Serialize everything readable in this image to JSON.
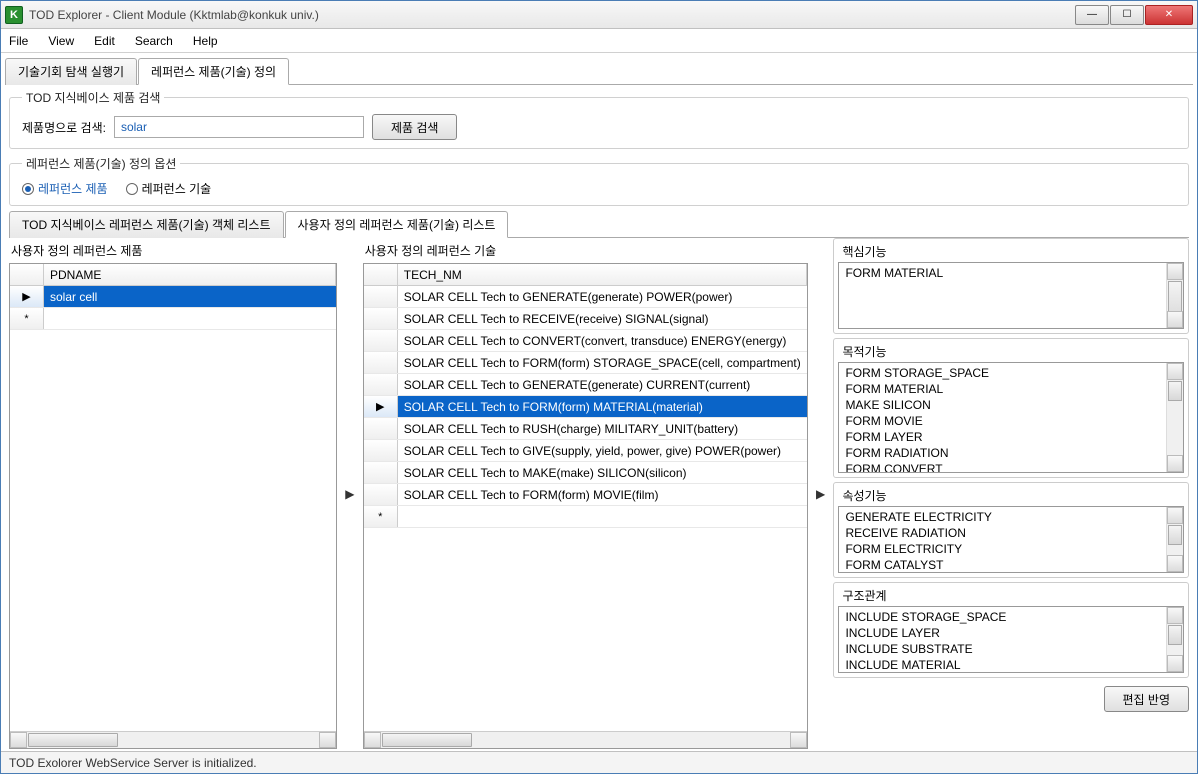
{
  "window": {
    "title": "TOD Explorer - Client Module (Kktmlab@konkuk univ.)",
    "icon_letter": "K"
  },
  "menu": {
    "file": "File",
    "view": "View",
    "edit": "Edit",
    "search": "Search",
    "help": "Help"
  },
  "outer_tabs": {
    "tab1": "기술기회 탐색 실행기",
    "tab2": "레퍼런스 제품(기술) 정의"
  },
  "search_box": {
    "legend": "TOD 지식베이스 제품 검색",
    "label": "제품명으로 검색:",
    "value": "solar",
    "button": "제품 검색"
  },
  "options_box": {
    "legend": "레퍼런스 제품(기술) 정의 옵션",
    "opt1": "레퍼런스 제품",
    "opt2": "레퍼런스 기술"
  },
  "inner_tabs": {
    "tab1": "TOD 지식베이스 레퍼런스 제품(기술) 객체 리스트",
    "tab2": "사용자 정의 레퍼런스 제품(기술) 리스트"
  },
  "left_panel": {
    "title": "사용자 정의 레퍼런스 제품",
    "col": "PDNAME",
    "rows": [
      "solar cell"
    ],
    "row_marker": "▶",
    "new_marker": "*"
  },
  "mid_panel": {
    "title": "사용자 정의 레퍼런스 기술",
    "col": "TECH_NM",
    "rows": [
      "SOLAR CELL Tech to GENERATE(generate) POWER(power)",
      "SOLAR CELL Tech to RECEIVE(receive) SIGNAL(signal)",
      "SOLAR CELL Tech to CONVERT(convert, transduce) ENERGY(energy)",
      "SOLAR CELL Tech to FORM(form) STORAGE_SPACE(cell, compartment)",
      "SOLAR CELL Tech to GENERATE(generate) CURRENT(current)",
      "SOLAR CELL Tech to FORM(form) MATERIAL(material)",
      "SOLAR CELL Tech to RUSH(charge) MILITARY_UNIT(battery)",
      "SOLAR CELL Tech to GIVE(supply, yield, power, give) POWER(power)",
      "SOLAR CELL Tech to MAKE(make) SILICON(silicon)",
      "SOLAR CELL Tech to FORM(form) MOVIE(film)"
    ],
    "selected_index": 5,
    "row_marker": "▶",
    "new_marker": "*"
  },
  "right_panels": {
    "core": {
      "title": "핵심기능",
      "items": [
        "FORM MATERIAL"
      ]
    },
    "purpose": {
      "title": "목적기능",
      "items": [
        "FORM STORAGE_SPACE",
        "FORM MATERIAL",
        "MAKE SILICON",
        "FORM MOVIE",
        "FORM LAYER",
        "FORM RADIATION",
        "FORM CONVERT"
      ]
    },
    "attr": {
      "title": "속성기능",
      "items": [
        "GENERATE ELECTRICITY",
        "RECEIVE RADIATION",
        "FORM ELECTRICITY",
        "FORM CATALYST"
      ]
    },
    "struct": {
      "title": "구조관계",
      "items": [
        "INCLUDE STORAGE_SPACE",
        "INCLUDE LAYER",
        "INCLUDE SUBSTRATE",
        "INCLUDE MATERIAL"
      ]
    }
  },
  "apply_button": "편집 반영",
  "status": "TOD Exolorer WebService Server is initialized.",
  "arrow": "▶"
}
